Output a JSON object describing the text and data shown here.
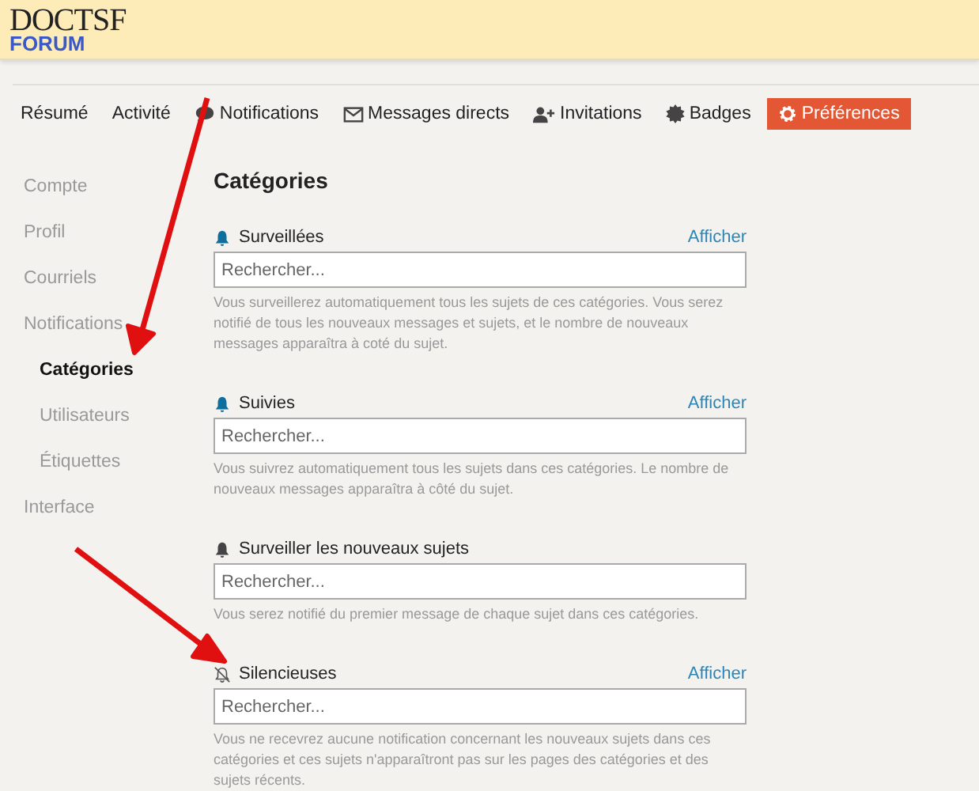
{
  "logo": {
    "title": "DOCTSF",
    "subtitle": "FORUM"
  },
  "nav": [
    {
      "label": "Résumé",
      "kind": "plain",
      "selected": false
    },
    {
      "label": "Activité",
      "kind": "plain",
      "selected": false
    },
    {
      "label": "Notifications",
      "kind": "comment",
      "selected": false
    },
    {
      "label": "Messages directs",
      "kind": "envelope",
      "selected": false
    },
    {
      "label": "Invitations",
      "kind": "invite",
      "selected": false
    },
    {
      "label": "Badges",
      "kind": "badge",
      "selected": false
    },
    {
      "label": "Préférences",
      "kind": "settings",
      "selected": true
    }
  ],
  "sidebar": {
    "items": [
      {
        "label": "Compte",
        "selected": false
      },
      {
        "label": "Profil",
        "selected": false
      },
      {
        "label": "Courriels",
        "selected": false
      },
      {
        "label": "Notifications",
        "selected": false,
        "children": [
          {
            "label": "Catégories",
            "selected": true
          },
          {
            "label": "Utilisateurs",
            "selected": false
          },
          {
            "label": "Étiquettes",
            "selected": false
          }
        ]
      },
      {
        "label": "Interface",
        "selected": false
      }
    ]
  },
  "heading": "Catégories",
  "sections": [
    {
      "kind": "bell",
      "title": "Surveillées",
      "link": "Afficher",
      "placeholder": "Rechercher...",
      "description": "Vous surveillerez automatiquement tous les sujets de ces catégories. Vous serez notifié de tous les nouveaux messages et sujets, et le nombre de nouveaux messages apparaîtra à coté du sujet."
    },
    {
      "kind": "bell",
      "title": "Suivies",
      "link": "Afficher",
      "placeholder": "Rechercher...",
      "description": "Vous suivrez automatiquement tous les sujets dans ces catégories. Le nombre de nouveaux messages apparaîtra à côté du sujet."
    },
    {
      "kind": "bell-dark",
      "title": "Surveiller les nouveaux sujets",
      "placeholder": "Rechercher...",
      "description": "Vous serez notifié du premier message de chaque sujet dans ces catégories."
    },
    {
      "kind": "bell-slash",
      "title": "Silencieuses",
      "link": "Afficher",
      "placeholder": "Rechercher...",
      "description": "Vous ne recevrez aucune notification concernant les nouveaux sujets dans ces catégories et ces sujets n'apparaîtront pas sur les pages des catégories et des sujets récents."
    }
  ]
}
